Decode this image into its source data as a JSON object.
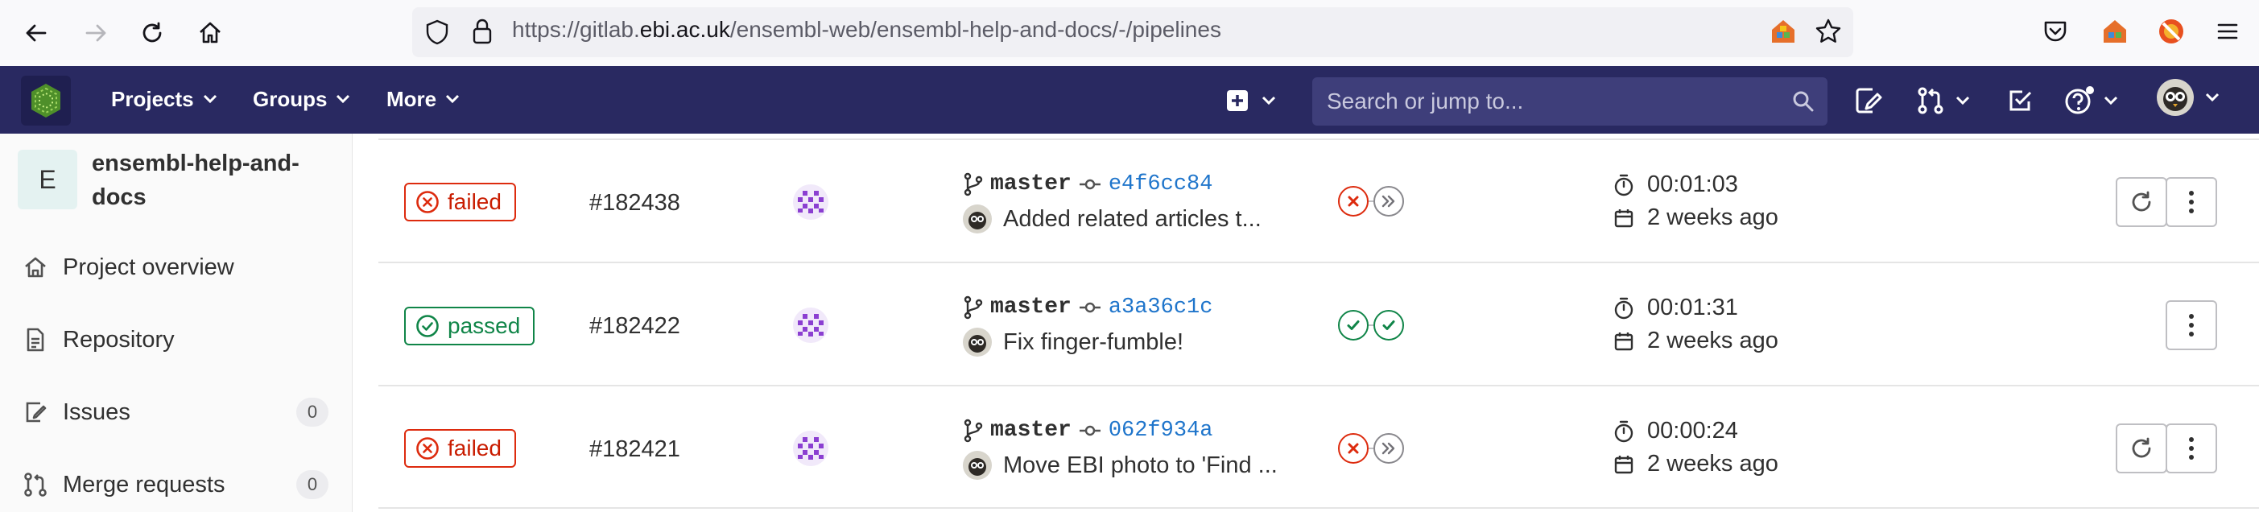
{
  "browser": {
    "url_prefix": "https://gitlab.",
    "url_domain": "ebi.ac.uk",
    "url_suffix": "/ensembl-web/ensembl-help-and-docs/-/pipelines"
  },
  "topnav": {
    "menus": [
      "Projects",
      "Groups",
      "More"
    ],
    "search_placeholder": "Search or jump to..."
  },
  "sidebar": {
    "project_initial": "E",
    "project_name": "ensembl-help-and-docs",
    "items": [
      {
        "label": "Project overview",
        "icon": "home-icon"
      },
      {
        "label": "Repository",
        "icon": "document-icon"
      },
      {
        "label": "Issues",
        "icon": "issues-icon",
        "count": "0"
      },
      {
        "label": "Merge requests",
        "icon": "merge-request-icon",
        "count": "0"
      }
    ]
  },
  "pipelines": [
    {
      "status": "failed",
      "id": "#182438",
      "branch": "master",
      "sha": "e4f6cc84",
      "commit_message": "Added related articles t...",
      "stages": [
        "failed",
        "skipped"
      ],
      "duration": "00:01:03",
      "finished": "2 weeks ago",
      "retry": true
    },
    {
      "status": "passed",
      "id": "#182422",
      "branch": "master",
      "sha": "a3a36c1c",
      "commit_message": "Fix finger-fumble!",
      "stages": [
        "passed",
        "passed"
      ],
      "duration": "00:01:31",
      "finished": "2 weeks ago",
      "retry": false
    },
    {
      "status": "failed",
      "id": "#182421",
      "branch": "master",
      "sha": "062f934a",
      "commit_message": "Move EBI photo to 'Find ...",
      "stages": [
        "failed",
        "skipped"
      ],
      "duration": "00:00:24",
      "finished": "2 weeks ago",
      "retry": true
    }
  ],
  "colors": {
    "nav_bg": "#292961",
    "failed": "#dd2b0e",
    "passed": "#108548",
    "link": "#1f75cb"
  }
}
